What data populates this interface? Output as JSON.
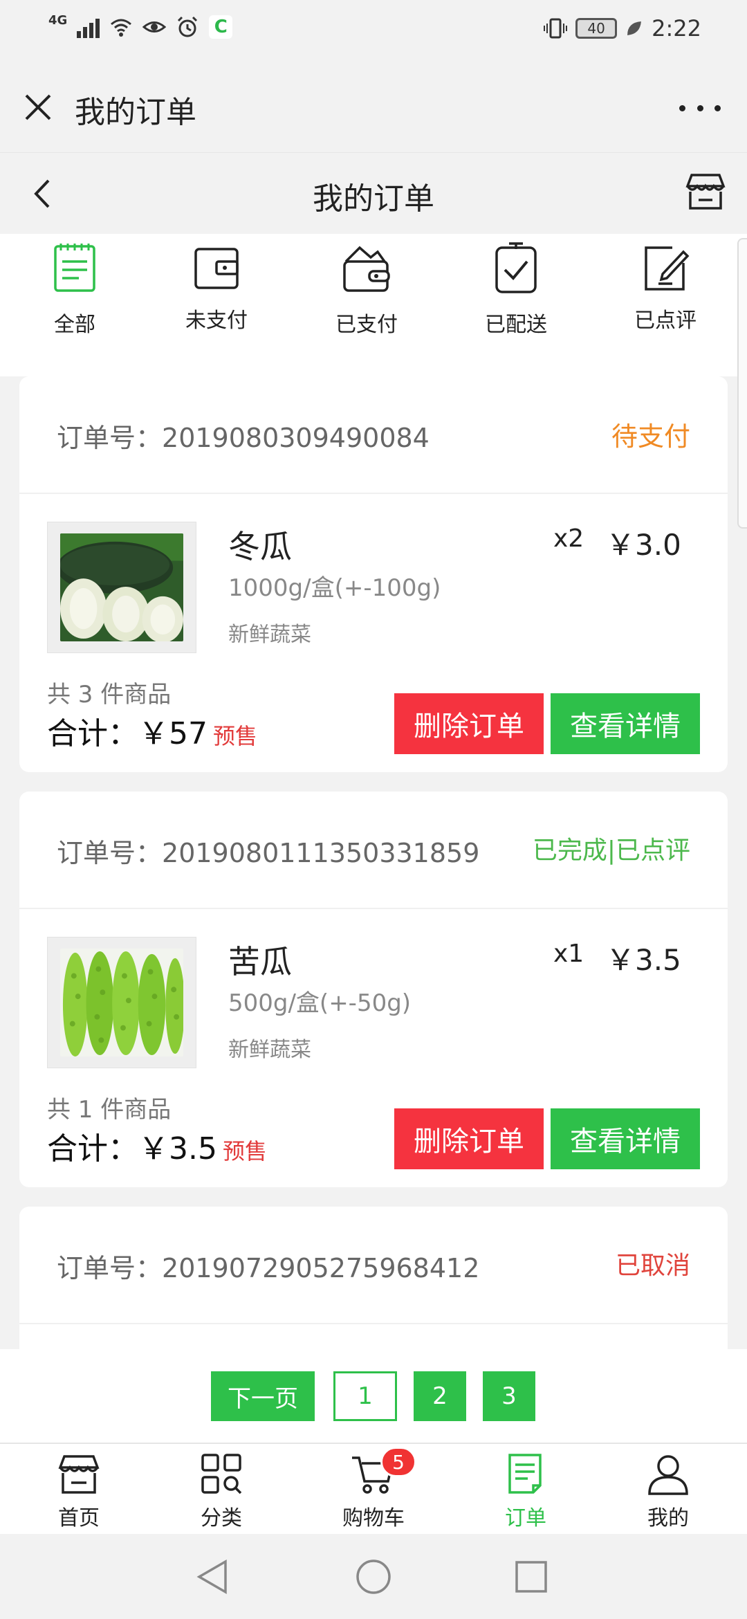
{
  "status_bar": {
    "network": "4G",
    "battery": "40",
    "time": "2:22",
    "icons": [
      "signal-icon",
      "wifi-icon",
      "eye-icon",
      "alarm-icon",
      "app-c-icon",
      "vibrate-icon",
      "battery-icon",
      "leaf-icon"
    ],
    "app_badge": "C"
  },
  "title_bar": {
    "title": "我的订单",
    "close_icon": "close-icon",
    "more_icon": "more-icon"
  },
  "page_header": {
    "title": "我的订单",
    "back_icon": "back-icon",
    "store_icon": "store-icon"
  },
  "filter_tabs": [
    {
      "label": "全部",
      "icon": "list-doc-icon",
      "active": true
    },
    {
      "label": "未支付",
      "icon": "wallet-icon",
      "active": false
    },
    {
      "label": "已支付",
      "icon": "wallet-open-icon",
      "active": false
    },
    {
      "label": "已配送",
      "icon": "clipboard-check-icon",
      "active": false
    },
    {
      "label": "已点评",
      "icon": "edit-icon",
      "active": false
    }
  ],
  "orders": [
    {
      "order_label": "订单号：",
      "order_no": "2019080309490084",
      "status": "待支付",
      "status_color": "#f08a24",
      "item": {
        "name": "冬瓜",
        "spec": "1000g/盒(+-100g)",
        "category": "新鲜蔬菜",
        "qty": "x2",
        "price": "￥3.0"
      },
      "count_text": "共 3 件商品",
      "total_text": "合计：￥57",
      "presale": "预售",
      "delete_label": "删除订单",
      "detail_label": "查看详情"
    },
    {
      "order_label": "订单号：",
      "order_no": "2019080111350331859",
      "status": "已完成|已点评",
      "status_color": "#4cb84c",
      "item": {
        "name": "苦瓜",
        "spec": "500g/盒(+-50g)",
        "category": "新鲜蔬菜",
        "qty": "x1",
        "price": "￥3.5"
      },
      "count_text": "共 1 件商品",
      "total_text": "合计：￥3.5",
      "presale": "预售",
      "delete_label": "删除订单",
      "detail_label": "查看详情"
    },
    {
      "order_label": "订单号：",
      "order_no": "2019072905275968412",
      "status": "已取消",
      "status_color": "#e0443c"
    }
  ],
  "pagination": {
    "next_label": "下一页",
    "pages": [
      "1",
      "2",
      "3"
    ],
    "current_page": "1"
  },
  "bottom_nav": [
    {
      "label": "首页",
      "icon": "home-store-icon",
      "active": false
    },
    {
      "label": "分类",
      "icon": "category-grid-icon",
      "active": false
    },
    {
      "label": "购物车",
      "icon": "cart-icon",
      "active": false,
      "badge": "5"
    },
    {
      "label": "订单",
      "icon": "order-doc-icon",
      "active": true
    },
    {
      "label": "我的",
      "icon": "user-icon",
      "active": false
    }
  ],
  "system_nav": {
    "icons": [
      "back-triangle-icon",
      "home-circle-icon",
      "recents-square-icon"
    ]
  },
  "colors": {
    "accent_green": "#2ec04a",
    "delete_red": "#f5333f",
    "pending_orange": "#f08a24"
  }
}
